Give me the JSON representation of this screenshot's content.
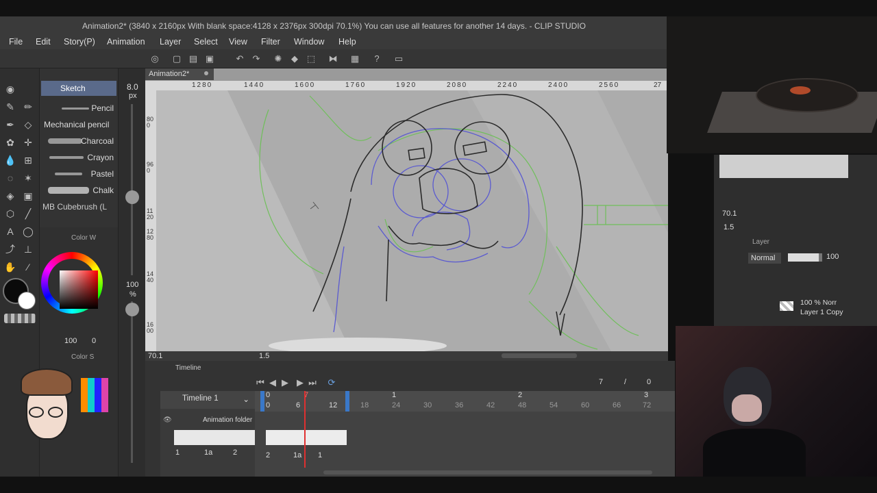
{
  "window": {
    "title": "Animation2* (3840 x 2160px With blank space:4128 x 2376px 300dpi 70.1%)  You can use all features for another 14 days. - CLIP STUDIO"
  },
  "menu": [
    "File",
    "Edit",
    "Story(P)",
    "Animation",
    "Layer",
    "Select",
    "View",
    "Filter",
    "Window",
    "Help"
  ],
  "document_tab": "Animation2*",
  "subtool": {
    "group": "Sketch",
    "brushes": [
      "Pencil",
      "Mechanical pencil",
      "Charcoal",
      "Crayon",
      "Pastel",
      "Chalk",
      "MB Cubebrush (L"
    ]
  },
  "brush_size": {
    "value": "8.0",
    "unit": "px"
  },
  "opacity": {
    "value": "100",
    "unit": "%"
  },
  "color_panel": {
    "title": "Color W",
    "sub_title": "Color S",
    "readout_v": "100",
    "readout_zero": "0",
    "current_color": "#0a0a0a",
    "secondary_color": "#ffffff"
  },
  "ruler_top_labels": [
    "1280",
    "1440",
    "1600",
    "1760",
    "1920",
    "2080",
    "2240",
    "2400",
    "2560",
    "27"
  ],
  "ruler_left_labels": [
    "800",
    "960",
    "1120",
    "1280",
    "1440",
    "1600"
  ],
  "canvas_footer": {
    "zoom": "70.1",
    "rotation": "1.5"
  },
  "timeline": {
    "title": "Timeline",
    "name": "Timeline 1",
    "current_frame": "7",
    "slash": "/",
    "end_frame": "0",
    "header_numbers": [
      "0",
      "6",
      "7",
      "12",
      "18",
      "24",
      "30",
      "36",
      "42",
      "48",
      "54",
      "60",
      "66",
      "72"
    ],
    "second_marks": [
      "1",
      "2",
      "3"
    ],
    "folder_label": "Animation folder",
    "folder_cells": [
      "1",
      "1a",
      "2"
    ],
    "track_cells": [
      "2",
      "1a",
      "1"
    ]
  },
  "navigator": {
    "zoom": "70.1",
    "rotation": "1.5"
  },
  "layer_panel": {
    "title": "Layer",
    "blend_mode": "Normal",
    "opacity": "100",
    "layer_meta": "100 % Norr",
    "layer_name": "Layer 1 Copy"
  },
  "colors": {
    "sketch_green": "#6fbf5a",
    "sketch_blue": "#5a5ad0",
    "playhead_red": "#e03030",
    "ui_dark": "#333333"
  }
}
